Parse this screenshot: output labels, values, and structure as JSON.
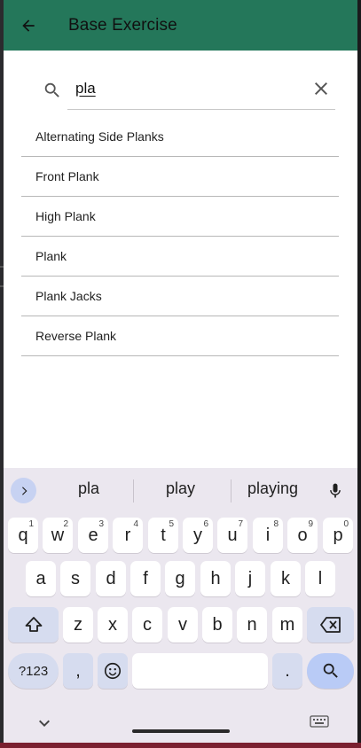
{
  "appbar": {
    "title": "Base Exercise",
    "back_icon": "arrow-back-icon",
    "color": "#24775a"
  },
  "search": {
    "value": "pla",
    "search_icon": "search-icon",
    "clear_icon": "close-icon"
  },
  "results": [
    "Alternating Side Planks",
    "Front Plank",
    "High Plank",
    "Plank",
    "Plank Jacks",
    "Reverse Plank"
  ],
  "keyboard": {
    "suggestions": [
      "pla",
      "play",
      "playing"
    ],
    "row1": [
      {
        "k": "q",
        "h": "1"
      },
      {
        "k": "w",
        "h": "2"
      },
      {
        "k": "e",
        "h": "3"
      },
      {
        "k": "r",
        "h": "4"
      },
      {
        "k": "t",
        "h": "5"
      },
      {
        "k": "y",
        "h": "6"
      },
      {
        "k": "u",
        "h": "7"
      },
      {
        "k": "i",
        "h": "8"
      },
      {
        "k": "o",
        "h": "9"
      },
      {
        "k": "p",
        "h": "0"
      }
    ],
    "row2": [
      "a",
      "s",
      "d",
      "f",
      "g",
      "h",
      "j",
      "k",
      "l"
    ],
    "row3": [
      "z",
      "x",
      "c",
      "v",
      "b",
      "n",
      "m"
    ],
    "symbols_label": "?123",
    "comma_label": ",",
    "period_label": ".",
    "accent": "#b9cbf6"
  }
}
